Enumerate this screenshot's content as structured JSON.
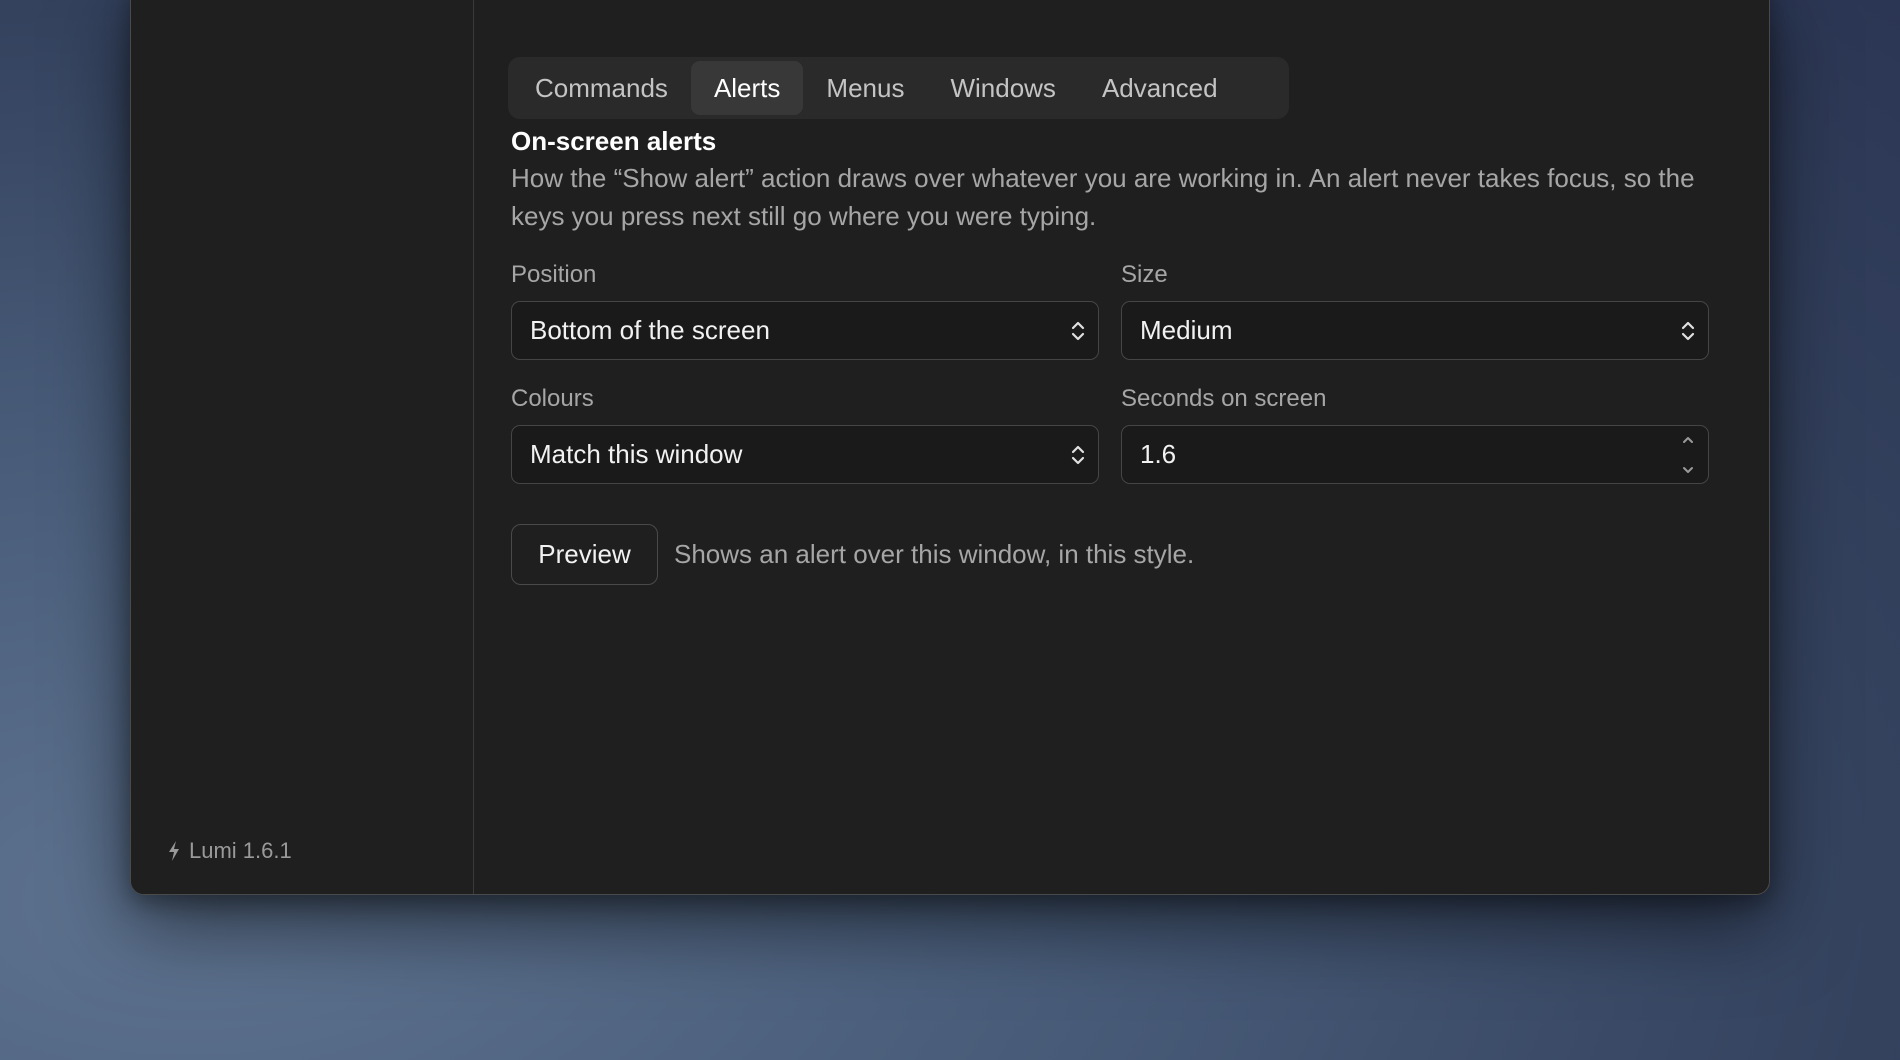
{
  "sidebar": {
    "version": "Lumi 1.6.1",
    "version_icon": "bolt-icon"
  },
  "tabs": [
    {
      "label": "Commands",
      "active": false
    },
    {
      "label": "Alerts",
      "active": true
    },
    {
      "label": "Menus",
      "active": false
    },
    {
      "label": "Windows",
      "active": false
    },
    {
      "label": "Advanced",
      "active": false
    }
  ],
  "section": {
    "title": "On-screen alerts",
    "description": "How the “Show alert” action draws over whatever you are working in. An alert never takes focus, so the keys you press next still go where you were typing."
  },
  "fields": {
    "position": {
      "label": "Position",
      "value": "Bottom of the screen"
    },
    "size": {
      "label": "Size",
      "value": "Medium"
    },
    "colours": {
      "label": "Colours",
      "value": "Match this window"
    },
    "seconds": {
      "label": "Seconds on screen",
      "value": "1.6"
    }
  },
  "preview": {
    "button_label": "Preview",
    "hint": "Shows an alert over this window, in this style."
  },
  "colors": {
    "window_bg": "#1f1f1f",
    "tab_active_bg": "#383838",
    "text_primary": "#ffffff",
    "text_secondary": "#a6a6a6"
  }
}
